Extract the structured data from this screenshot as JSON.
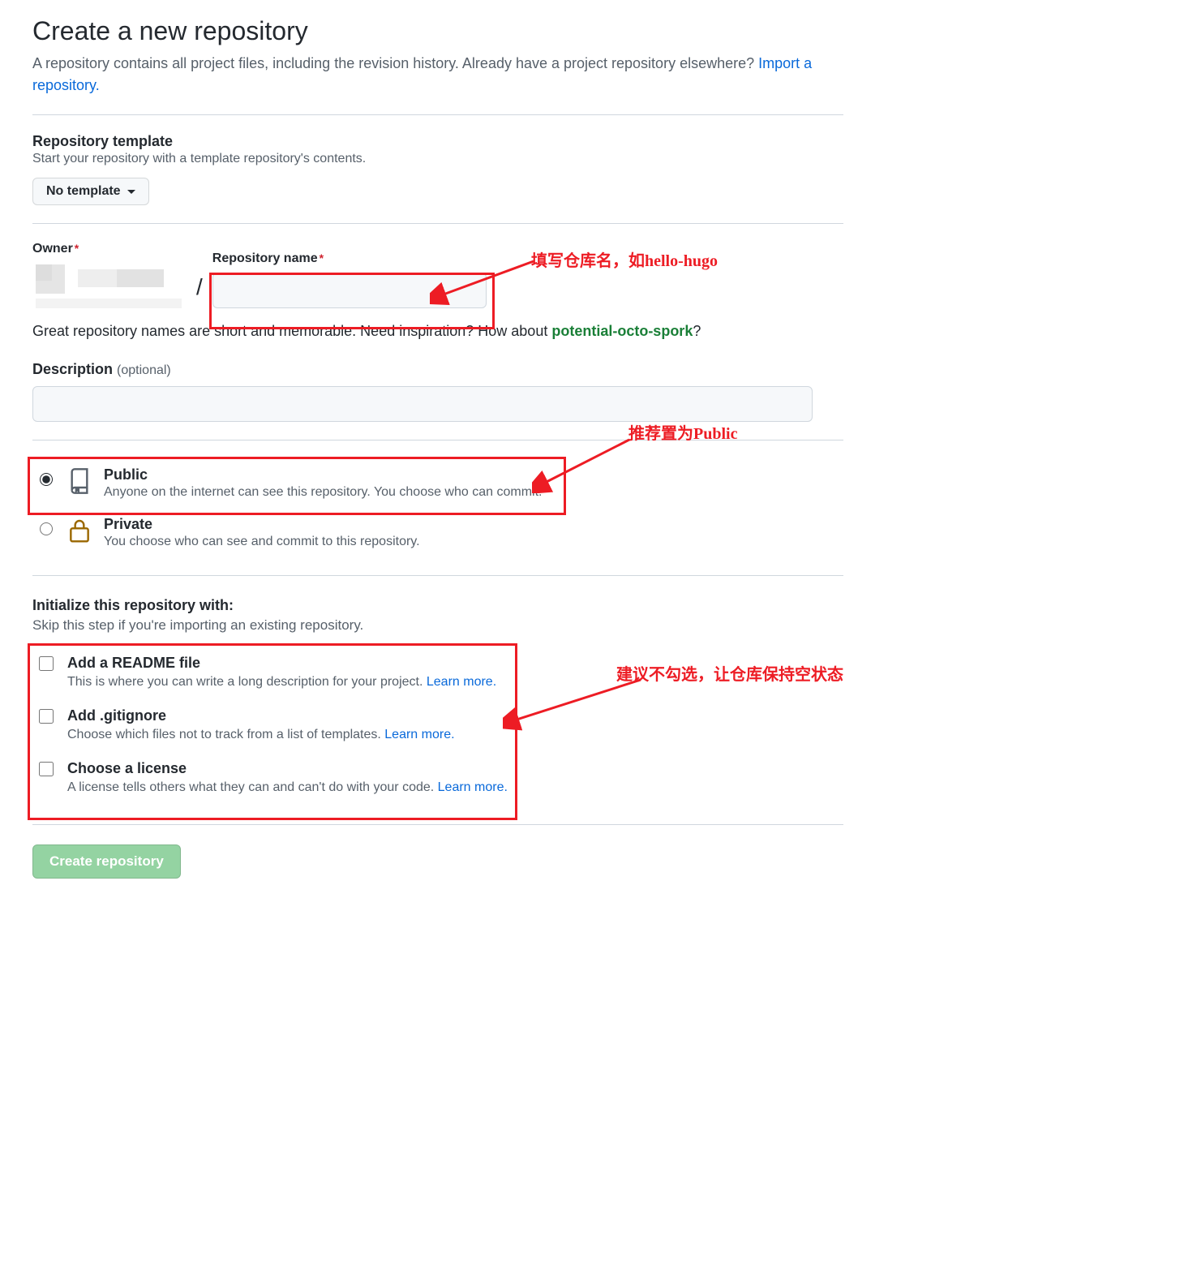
{
  "header": {
    "title": "Create a new repository",
    "subtitle_prefix": "A repository contains all project files, including the revision history. Already have a project repository elsewhere? ",
    "import_link": "Import a repository."
  },
  "template": {
    "label": "Repository template",
    "desc": "Start your repository with a template repository's contents.",
    "button": "No template"
  },
  "owner": {
    "label": "Owner",
    "repo_label": "Repository name"
  },
  "hint": {
    "text_prefix": "Great repository names are short and memorable. Need inspiration? How about ",
    "suggestion": "potential-octo-spork",
    "text_suffix": "?"
  },
  "description": {
    "label": "Description",
    "optional": "(optional)"
  },
  "visibility": {
    "public": {
      "title": "Public",
      "desc": "Anyone on the internet can see this repository. You choose who can commit."
    },
    "private": {
      "title": "Private",
      "desc": "You choose who can see and commit to this repository."
    }
  },
  "init": {
    "label": "Initialize this repository with:",
    "desc": "Skip this step if you're importing an existing repository.",
    "readme": {
      "title": "Add a README file",
      "desc": "This is where you can write a long description for your project. ",
      "link": "Learn more."
    },
    "gitignore": {
      "title": "Add .gitignore",
      "desc": "Choose which files not to track from a list of templates. ",
      "link": "Learn more."
    },
    "license": {
      "title": "Choose a license",
      "desc": "A license tells others what they can and can't do with your code. ",
      "link": "Learn more."
    }
  },
  "submit": {
    "label": "Create repository"
  },
  "annotations": {
    "repo_name": "填写仓库名，如hello-hugo",
    "public": "推荐置为Public",
    "init": "建议不勾选，让仓库保持空状态"
  }
}
